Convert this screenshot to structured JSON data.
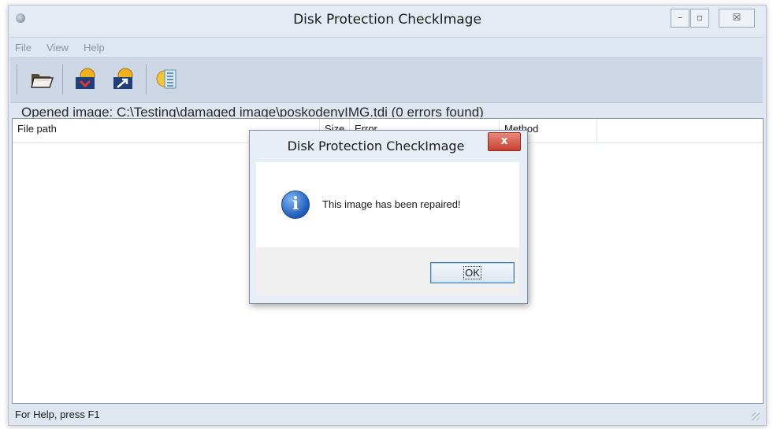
{
  "window": {
    "title": "Disk Protection CheckImage",
    "controls": {
      "minimize": "–",
      "maximize": "▫",
      "close": "☒"
    }
  },
  "menu": {
    "items": [
      "File",
      "View",
      "Help"
    ]
  },
  "toolbar": {
    "buttons": [
      "open-folder-icon",
      "check-image-icon",
      "repair-image-icon",
      "settings-list-icon"
    ]
  },
  "info": {
    "opened_image": "Opened image:  C:\\Testing\\damaged image\\poskodenyIMG.tdi  (0 errors found)"
  },
  "list": {
    "columns": [
      "File path",
      "Size",
      "Error",
      "Method"
    ]
  },
  "status": {
    "text": "For Help, press F1"
  },
  "dialog": {
    "title": "Disk Protection CheckImage",
    "close": "x",
    "icon": "information-icon",
    "message": "This image has been repaired!",
    "ok_label": "OK"
  }
}
